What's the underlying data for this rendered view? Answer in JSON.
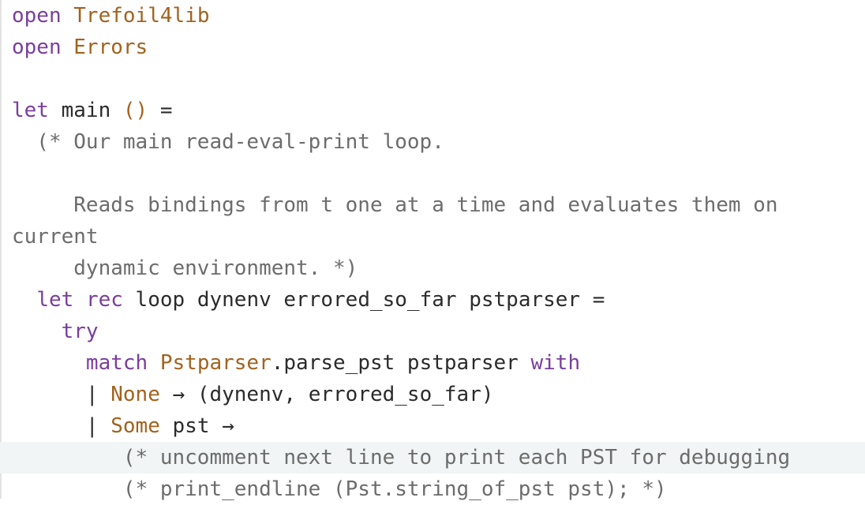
{
  "editor": {
    "lines": [
      [
        {
          "t": "open",
          "c": "kw"
        },
        {
          "t": " ",
          "c": "op"
        },
        {
          "t": "Trefoil4lib",
          "c": "mod"
        }
      ],
      [
        {
          "t": "open",
          "c": "kw"
        },
        {
          "t": " ",
          "c": "op"
        },
        {
          "t": "Errors",
          "c": "mod"
        }
      ],
      [],
      [
        {
          "t": "let",
          "c": "kw"
        },
        {
          "t": " main ",
          "c": "op"
        },
        {
          "t": "()",
          "c": "mod"
        },
        {
          "t": " =",
          "c": "op"
        }
      ],
      [
        {
          "t": "  (* Our main read-eval-print loop.",
          "c": "cm"
        }
      ],
      [],
      [
        {
          "t": "     Reads bindings from t one at a time and evaluates them on",
          "c": "cm"
        }
      ],
      [
        {
          "t": "current",
          "c": "cm"
        }
      ],
      [
        {
          "t": "     dynamic environment. *)",
          "c": "cm"
        }
      ],
      [
        {
          "t": "  ",
          "c": "op"
        },
        {
          "t": "let",
          "c": "kw"
        },
        {
          "t": " ",
          "c": "op"
        },
        {
          "t": "rec",
          "c": "kw"
        },
        {
          "t": " loop dynenv errored_so_far pstparser =",
          "c": "op"
        }
      ],
      [
        {
          "t": "    ",
          "c": "op"
        },
        {
          "t": "try",
          "c": "kw"
        }
      ],
      [
        {
          "t": "      ",
          "c": "op"
        },
        {
          "t": "match",
          "c": "kw"
        },
        {
          "t": " ",
          "c": "op"
        },
        {
          "t": "Pstparser",
          "c": "mod"
        },
        {
          "t": ".parse_pst pstparser ",
          "c": "op"
        },
        {
          "t": "with",
          "c": "kw"
        }
      ],
      [
        {
          "t": "      | ",
          "c": "op"
        },
        {
          "t": "None",
          "c": "ctor"
        },
        {
          "t": " → (dynenv, errored_so_far)",
          "c": "op"
        }
      ],
      [
        {
          "t": "      | ",
          "c": "op"
        },
        {
          "t": "Some",
          "c": "ctor"
        },
        {
          "t": " pst →",
          "c": "op"
        }
      ],
      [
        {
          "t": "         (* uncomment next line to print each PST for debugging",
          "c": "cm"
        }
      ],
      [
        {
          "t": "         (* print_endline (Pst.string_of_pst pst); *)",
          "c": "cm"
        }
      ]
    ],
    "current_line_index": 14
  }
}
